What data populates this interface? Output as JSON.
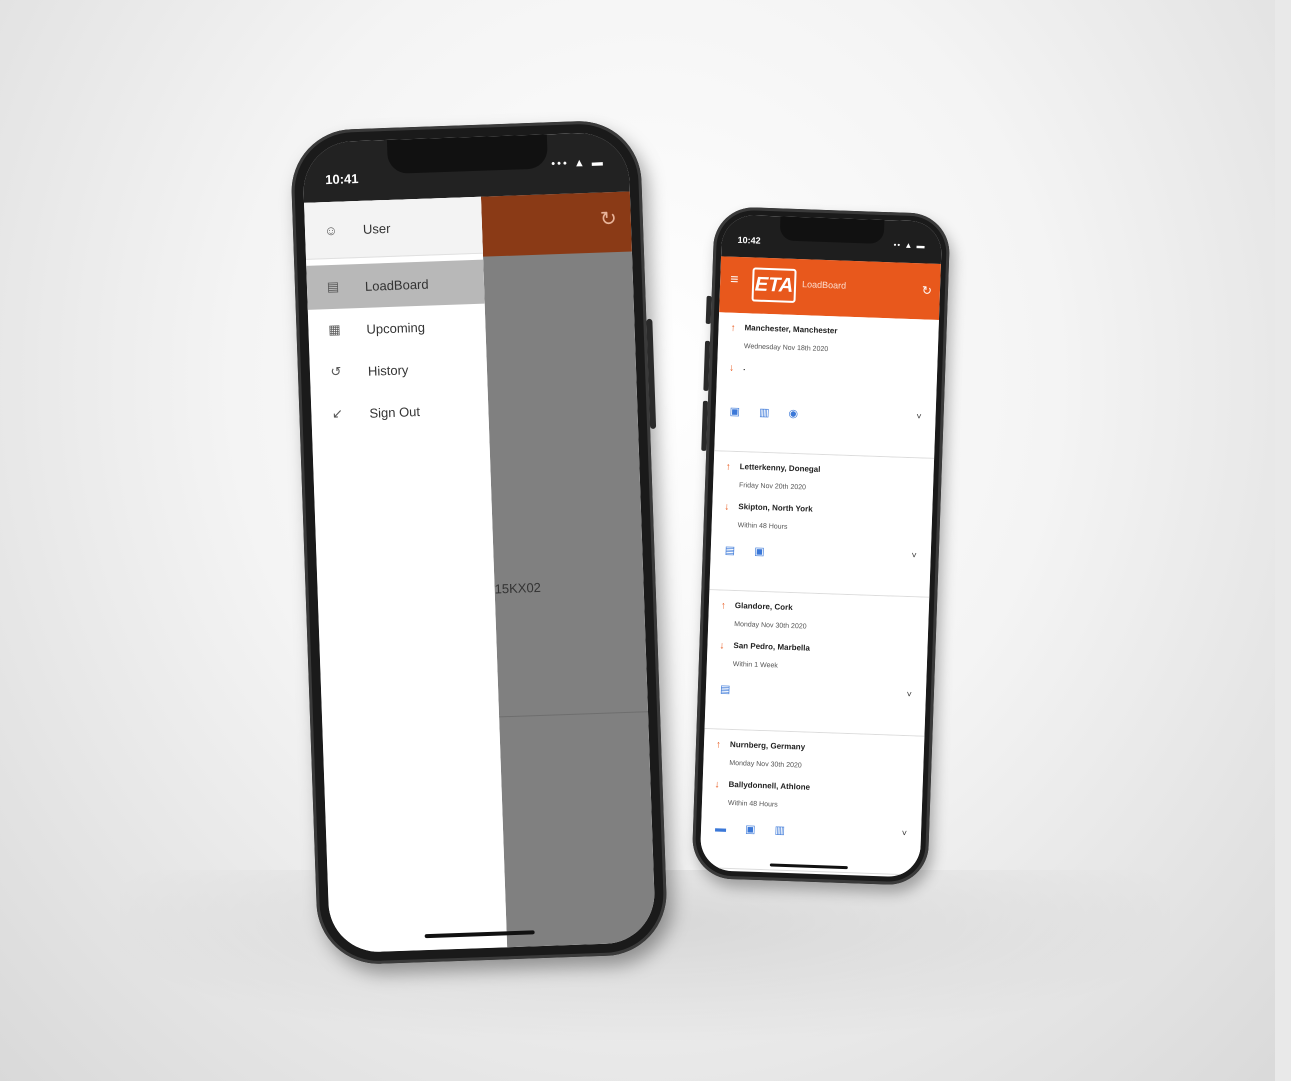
{
  "phone_left": {
    "status_time": "10:41",
    "status_icons": "••• ▲ ▬",
    "refresh_icon": "↻",
    "drawer": {
      "items": [
        {
          "label": "User",
          "icon": "☺"
        },
        {
          "label": "LoadBoard",
          "icon": "▤"
        },
        {
          "label": "Upcoming",
          "icon": "▦"
        },
        {
          "label": "History",
          "icon": "↺"
        },
        {
          "label": "Sign Out",
          "icon": "↙"
        }
      ]
    },
    "background_text": "15KX02"
  },
  "phone_right": {
    "status_time": "10:42",
    "status_icons": "•• ▲ ▬",
    "header": {
      "menu_icon": "≡",
      "logo_text": "ETA",
      "title": "LoadBoard",
      "refresh_icon": "↻"
    },
    "loads": [
      {
        "pickup": "Manchester, Manchester",
        "pickup_date": "Wednesday Nov 18th 2020",
        "dropoff": ".",
        "dropoff_window": "",
        "icons": "▣ ▥ ◉"
      },
      {
        "pickup": "Letterkenny, Donegal",
        "pickup_date": "Friday Nov 20th 2020",
        "dropoff": "Skipton, North York",
        "dropoff_window": "Within 48 Hours",
        "icons": "▤ ▣"
      },
      {
        "pickup": "Glandore, Cork",
        "pickup_date": "Monday Nov 30th 2020",
        "dropoff": "San Pedro, Marbella",
        "dropoff_window": "Within 1 Week",
        "icons": "▤"
      },
      {
        "pickup": "Nurnberg, Germany",
        "pickup_date": "Monday Nov 30th 2020",
        "dropoff": "Ballydonnell, Athlone",
        "dropoff_window": "Within 48 Hours",
        "icons": "▬ ▣ ▥"
      }
    ],
    "chevron_icon": "˅",
    "up_arrow": "↑",
    "down_arrow": "↓"
  },
  "colors": {
    "brand_orange": "#e8581c",
    "dark_orange": "#8a3a16"
  }
}
